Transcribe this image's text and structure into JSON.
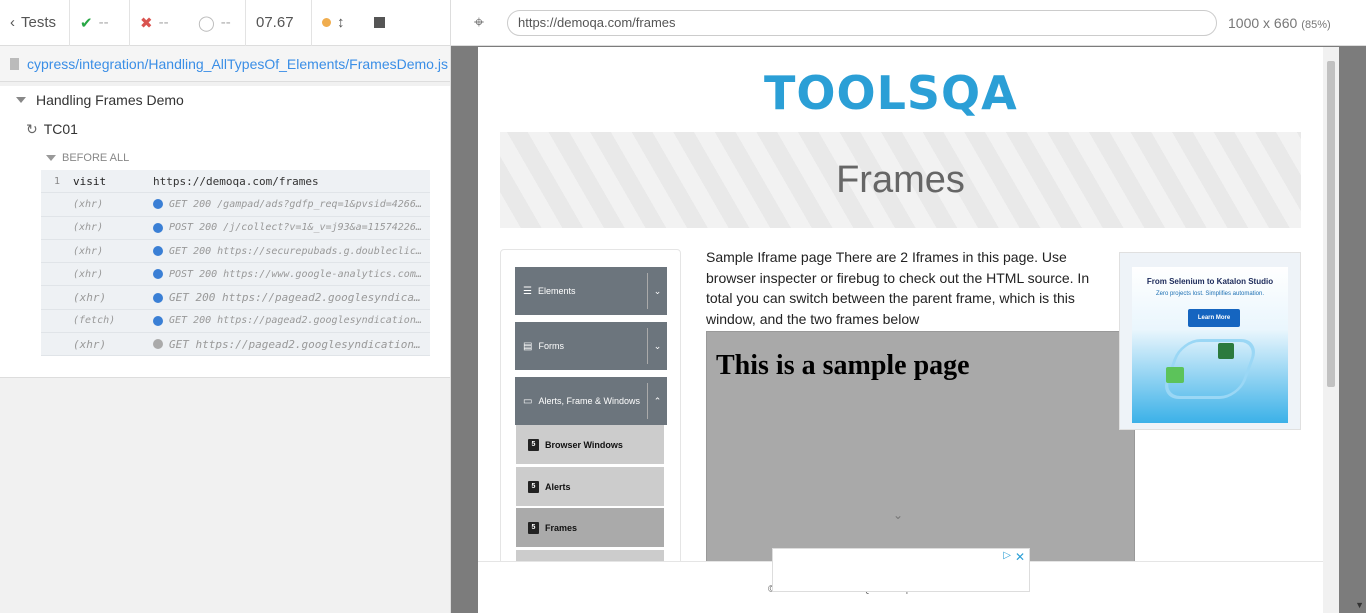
{
  "reporter": {
    "back_label": "Tests",
    "passed": "--",
    "failed": "--",
    "pending": "--",
    "duration": "07.67",
    "spec_path": "cypress/integration/Handling_AllTypesOf_Elements/FramesDemo.js",
    "suite_title": "Handling Frames Demo",
    "test_title": "TC01",
    "hook_label": "BEFORE ALL",
    "commands": [
      {
        "num": "1",
        "name": "visit",
        "message": "https://demoqa.com/frames",
        "dot": "",
        "style": "plain"
      },
      {
        "num": "",
        "name": "(xhr)",
        "message": "GET 200 /gampad/ads?gdfp_req=1&pvsid=4266405…",
        "dot": "blue",
        "style": "small"
      },
      {
        "num": "",
        "name": "(xhr)",
        "message": "POST 200 /j/collect?v=1&_v=j93&a=1157422624&…",
        "dot": "blue",
        "style": "small"
      },
      {
        "num": "",
        "name": "(xhr)",
        "message": "GET 200 https://securepubads.g.doubleclick.n…",
        "dot": "blue",
        "style": "small"
      },
      {
        "num": "",
        "name": "(xhr)",
        "message": "POST 200 https://www.google-analytics.com/j/…",
        "dot": "blue",
        "style": "small"
      },
      {
        "num": "",
        "name": "(xhr)",
        "message": "GET 200 https://pagead2.googlesyndica…",
        "dot": "blue",
        "style": "big"
      },
      {
        "num": "",
        "name": "(fetch)",
        "message": "GET 200 https://pagead2.googlesyndication.co…",
        "dot": "blue",
        "style": "small"
      },
      {
        "num": "",
        "name": "(xhr)",
        "message": "GET https://pagead2.googlesyndication…",
        "dot": "grey",
        "style": "big"
      }
    ]
  },
  "aut": {
    "url": "https://demoqa.com/frames",
    "viewport_size": "1000 x 660",
    "viewport_scale": "(85%)",
    "logo_text": "TOOLSQA",
    "page_title": "Frames",
    "menu": {
      "groups": [
        {
          "label": "Elements",
          "arrow": "⌄"
        },
        {
          "label": "Forms",
          "arrow": "⌄"
        },
        {
          "label": "Alerts, Frame & Windows",
          "arrow": "⌃"
        }
      ],
      "subitems": [
        {
          "label": "Browser Windows"
        },
        {
          "label": "Alerts"
        },
        {
          "label": "Frames"
        }
      ]
    },
    "description": "Sample Iframe page There are 2 Iframes in this page. Use browser inspecter or firebug to check out the HTML source. In total you can switch between the parent frame, which is this window, and the two frames below",
    "iframe_heading": "This is a sample page",
    "ad": {
      "headline": "From Selenium to Katalon Studio",
      "subline": "Zero projects lost. Simplifies automation.",
      "button": "Learn More"
    },
    "footer_text": "© 2013-2020 TOOLSQA.COM | ALL RIGHTS RESERVED."
  },
  "colors": {
    "accent": "#3a8ee6",
    "pass": "#28a745",
    "fail": "#d9534f",
    "running": "#f0ad4e",
    "menu_group": "#6c757d"
  }
}
